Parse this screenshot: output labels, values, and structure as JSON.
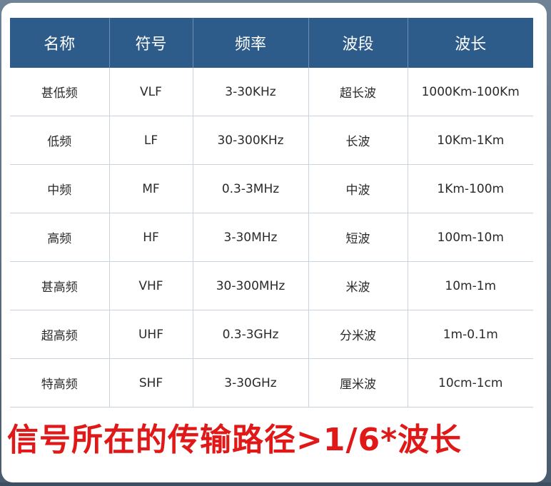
{
  "table": {
    "headers": [
      "名称",
      "符号",
      "频率",
      "波段",
      "波长"
    ],
    "rows": [
      [
        "甚低频",
        "VLF",
        "3-30KHz",
        "超长波",
        "1000Km-100Km"
      ],
      [
        "低频",
        "LF",
        "30-300KHz",
        "长波",
        "10Km-1Km"
      ],
      [
        "中频",
        "MF",
        "0.3-3MHz",
        "中波",
        "1Km-100m"
      ],
      [
        "高频",
        "HF",
        "3-30MHz",
        "短波",
        "100m-10m"
      ],
      [
        "甚高频",
        "VHF",
        "30-300MHz",
        "米波",
        "10m-1m"
      ],
      [
        "超高频",
        "UHF",
        "0.3-3GHz",
        "分米波",
        "1m-0.1m"
      ],
      [
        "特高频",
        "SHF",
        "3-30GHz",
        "厘米波",
        "10cm-1cm"
      ]
    ]
  },
  "footer": {
    "caption": "信号所在的传输路径>1/6*波长"
  },
  "colors": {
    "header_bg": "#2e5c8a",
    "caption": "#e01818"
  }
}
